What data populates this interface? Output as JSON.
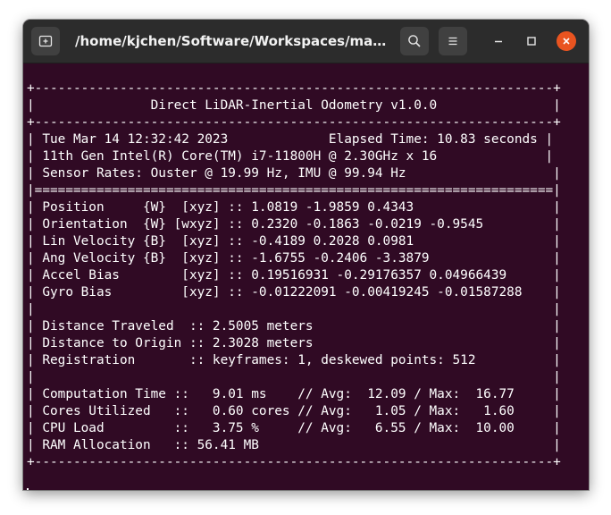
{
  "window": {
    "title": "/home/kjchen/Software/Workspaces/main/src/direct_lidar_inertial_odometry",
    "new_tab_icon": "new-tab-icon",
    "search_icon": "search-icon",
    "menu_icon": "hamburger-menu-icon",
    "minimize_icon": "minimize-icon",
    "maximize_icon": "maximize-icon",
    "close_icon": "close-icon",
    "close_color": "#e95420",
    "background_color": "#300a24"
  },
  "terminal": {
    "lines": [
      "+-------------------------------------------------------------------+",
      "|               Direct LiDAR-Inertial Odometry v1.0.0               |",
      "+-------------------------------------------------------------------+",
      "| Tue Mar 14 12:32:42 2023             Elapsed Time: 10.83 seconds |",
      "| 11th Gen Intel(R) Core(TM) i7-11800H @ 2.30GHz x 16              |",
      "| Sensor Rates: Ouster @ 19.99 Hz, IMU @ 99.94 Hz                   |",
      "|===================================================================|",
      "| Position     {W}  [xyz] :: 1.0819 -1.9859 0.4343                  |",
      "| Orientation  {W} [wxyz] :: 0.2320 -0.1863 -0.0219 -0.9545         |",
      "| Lin Velocity {B}  [xyz] :: -0.4189 0.2028 0.0981                  |",
      "| Ang Velocity {B}  [xyz] :: -1.6755 -0.2406 -3.3879                |",
      "| Accel Bias        [xyz] :: 0.19516931 -0.29176357 0.04966439      |",
      "| Gyro Bias         [xyz] :: -0.01222091 -0.00419245 -0.01587288    |",
      "|                                                                   |",
      "| Distance Traveled  :: 2.5005 meters                               |",
      "| Distance to Origin :: 2.3028 meters                               |",
      "| Registration       :: keyframes: 1, deskewed points: 512          |",
      "|                                                                   |",
      "| Computation Time ::   9.01 ms    // Avg:  12.09 / Max:  16.77     |",
      "| Cores Utilized   ::   0.60 cores // Avg:   1.05 / Max:   1.60     |",
      "| CPU Load         ::   3.75 %     // Avg:   6.55 / Max:  10.00     |",
      "| RAM Allocation   :: 56.41 MB                                      |",
      "+-------------------------------------------------------------------+"
    ]
  }
}
